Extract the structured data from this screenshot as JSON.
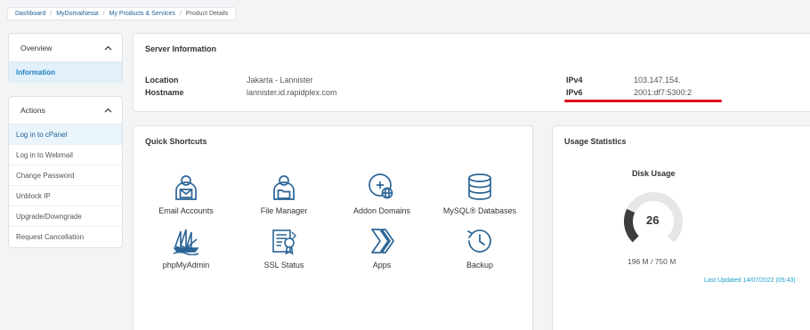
{
  "breadcrumb": [
    "Dashboard",
    "MyDomaiNesia",
    "My Products & Services",
    "Product Details"
  ],
  "sidebar": {
    "overview": {
      "title": "Overview",
      "item": "Information"
    },
    "actions": {
      "title": "Actions",
      "items": [
        "Log in to cPanel",
        "Log in to Webmail",
        "Change Password",
        "Unblock IP",
        "Upgrade/Downgrade",
        "Request Cancellation"
      ]
    }
  },
  "server": {
    "title": "Server Information",
    "location_label": "Location",
    "location_value": "Jakarta - Lannister",
    "hostname_label": "Hostname",
    "hostname_value": "lannister.id.rapidplex.com",
    "ipv4_label": "IPv4",
    "ipv4_value": "103.147.154.",
    "ipv6_label": "IPv6",
    "ipv6_value": "2001:df7:5300:2"
  },
  "shortcuts": {
    "title": "Quick Shortcuts",
    "items": [
      {
        "label": "Email Accounts",
        "icon": "email-accounts-icon"
      },
      {
        "label": "File Manager",
        "icon": "file-manager-icon"
      },
      {
        "label": "Addon Domains",
        "icon": "addon-domains-icon"
      },
      {
        "label": "MySQL® Databases",
        "icon": "database-icon"
      },
      {
        "label": "phpMyAdmin",
        "icon": "phpmyadmin-icon"
      },
      {
        "label": "SSL Status",
        "icon": "ssl-certificate-icon"
      },
      {
        "label": "Apps",
        "icon": "apps-icon"
      },
      {
        "label": "Backup",
        "icon": "backup-clock-icon"
      }
    ]
  },
  "usage": {
    "title": "Usage Statistics",
    "disk_title": "Disk Usage",
    "disk_value": "26",
    "disk_fraction": 0.26,
    "disk_detail": "196 M / 750 M",
    "last_updated": "Last Updated 14/07/2022 (05:43)"
  },
  "colors": {
    "icon_blue": "#2a6496",
    "link_blue": "#1e5f95",
    "accent_cyan": "#1a9fc9",
    "underline_red": "#d9001b",
    "gauge_dark": "#3d3d3d",
    "gauge_track": "#e6e6e6"
  }
}
